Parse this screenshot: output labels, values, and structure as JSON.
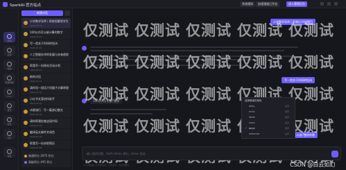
{
  "topbar": {
    "title": "SparkAI-官方站点",
    "buttons": [
      "系统通知",
      "加速通道已开启",
      "进入管理后台"
    ]
  },
  "rail": {
    "items": [
      {
        "label": "对话",
        "icon": "chat-icon"
      },
      {
        "label": "应用",
        "icon": "apps-icon"
      },
      {
        "label": "绘画",
        "icon": "brush-icon"
      },
      {
        "label": "思维导图",
        "icon": "mindmap-icon"
      },
      {
        "label": "Flux",
        "icon": "image-icon"
      },
      {
        "label": "音乐",
        "icon": "music-icon"
      },
      {
        "label": "会员",
        "icon": "crown-icon"
      },
      {
        "label": "分享",
        "icon": "share-icon"
      },
      {
        "label": "设置",
        "icon": "gear-icon"
      }
    ]
  },
  "sidebar": {
    "new_chat": "新建对话",
    "conversations": [
      {
        "title": "小学数学导师 | 帮助您解答学生问题",
        "date": "2024-07-12"
      },
      {
        "title": "100以内可以被计算的数字",
        "date": "2024-07-12"
      },
      {
        "title": "写一首关于时间的短诗",
        "date": "2024-07-12"
      },
      {
        "title": "人工智能技术的发展与未来趋势",
        "date": "2024-07-11"
      },
      {
        "title": "帮我写一份周末活动计划",
        "date": "2024-07-11"
      },
      {
        "title": "新的对话",
        "date": "2024-07-11"
      },
      {
        "title": "请你用一段话介绍量子计算原理",
        "date": "2024-07-10"
      },
      {
        "title": "小红书文案创作助手",
        "date": "2024-07-10"
      },
      {
        "title": "诗意旅行 · 写一篇游记散文",
        "date": "2024-07-10"
      },
      {
        "title": "请你帮我检查这段代码",
        "date": "2024-07-09"
      },
      {
        "title": "翻译英文邮件并润色",
        "date": "2024-07-09"
      },
      {
        "title": "帮我写一份求职简历",
        "date": "2024-07-09"
      },
      {
        "title": "新的对话",
        "date": "2024-07-08"
      },
      {
        "title": "如何提高工作效率",
        "date": "2024-07-08"
      }
    ],
    "stats": [
      {
        "label": "普通积分 2975 积分",
        "color": "#d9a441"
      },
      {
        "label": "高级积分 495 积分",
        "color": "#7c6dfc"
      }
    ]
  },
  "chat": {
    "user_bubble_1": "小学数学导师 | 帮我出10道题目",
    "user_bubble_2": "写一首关于时间的短诗",
    "user_bubble_3": "100以内可以被7整除的数",
    "ai_prefix": "100以内可以被7整除",
    "input_placeholder": "输入您的问题，Shift+Enter 换行，Enter 发送",
    "footer_text": "以上内容由人工智能生成，仅供参考，请注意甄别",
    "watermark": "仅测试"
  },
  "voice_menu": {
    "title": "选择朗读的音色",
    "options": [
      {
        "name": "alloy",
        "tag": "女声"
      },
      {
        "name": "echo",
        "tag": "男声"
      },
      {
        "name": "fable",
        "tag": "男声"
      },
      {
        "name": "nova",
        "tag": "女声"
      },
      {
        "name": "onyx",
        "tag": "男声"
      },
      {
        "name": "shimmer",
        "tag": "女声"
      }
    ],
    "selected_index": 4
  },
  "credit": "CSDN @白云如幻"
}
